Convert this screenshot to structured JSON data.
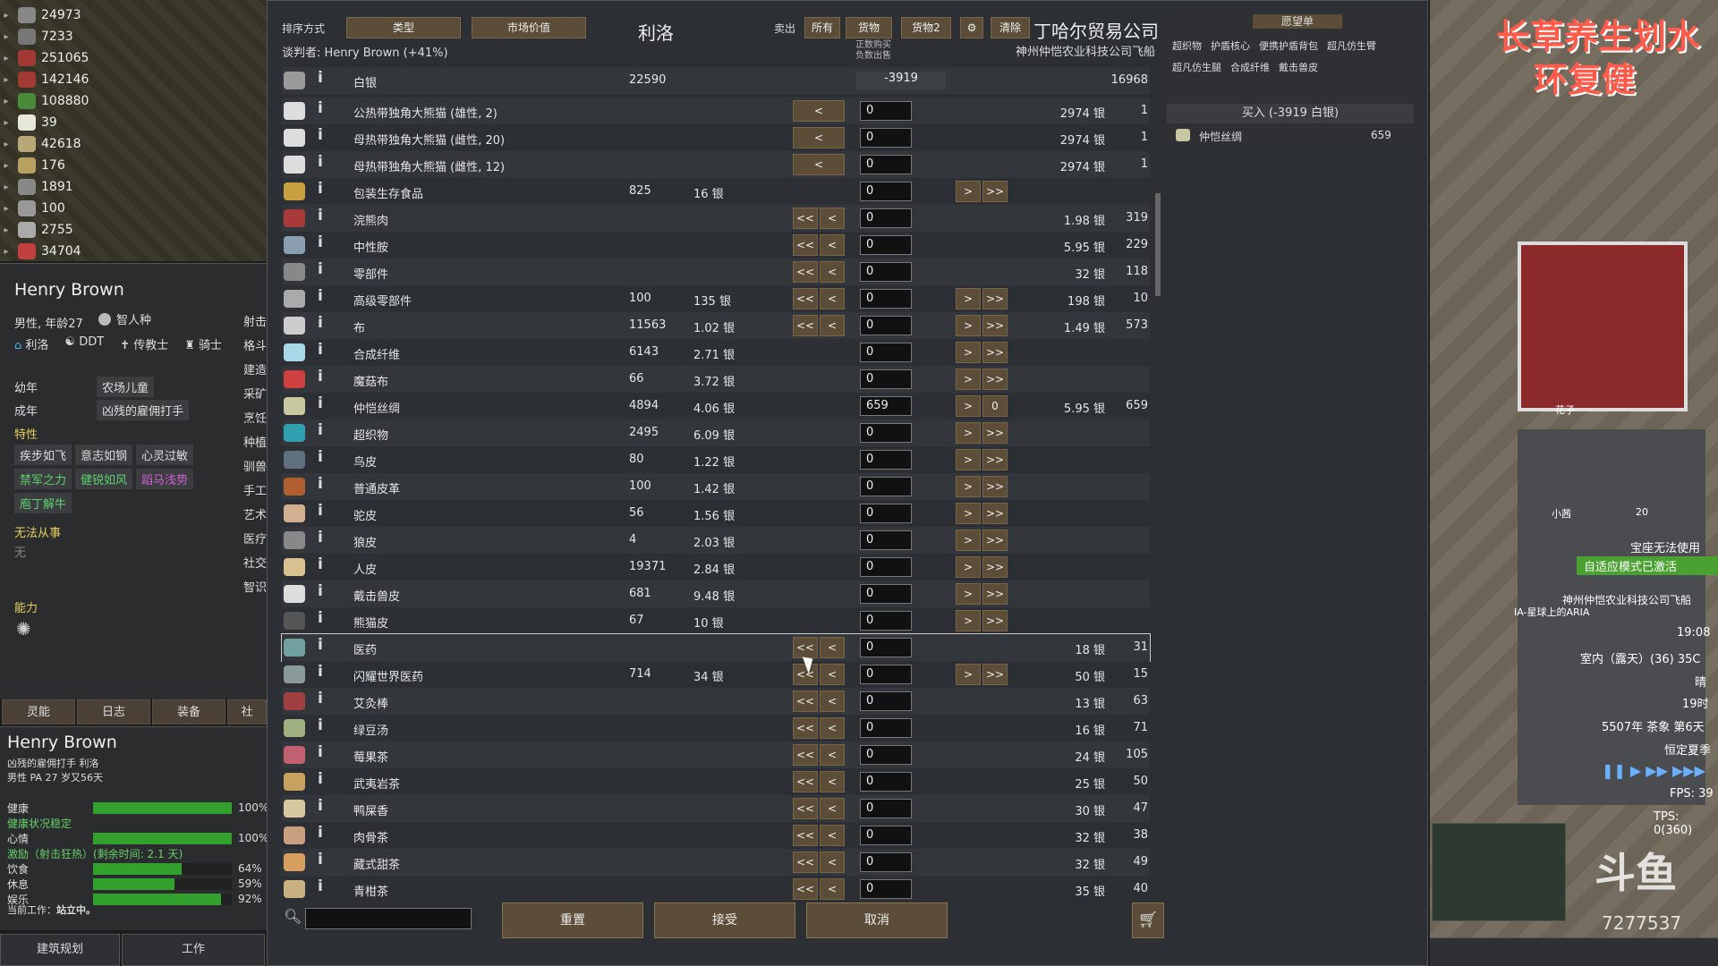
{
  "resources": [
    {
      "value": "24973",
      "color": "#888"
    },
    {
      "value": "7233",
      "color": "#777"
    },
    {
      "value": "251065",
      "color": "#a03a32"
    },
    {
      "value": "142146",
      "color": "#a03a32"
    },
    {
      "value": "108880",
      "color": "#4a8a3a"
    },
    {
      "value": "39",
      "color": "#e8e8d8"
    },
    {
      "value": "42618",
      "color": "#b8a878"
    },
    {
      "value": "176",
      "color": "#b8a060"
    },
    {
      "value": "1891",
      "color": "#888"
    },
    {
      "value": "100",
      "color": "#999"
    },
    {
      "value": "2755",
      "color": "#aaa"
    },
    {
      "value": "34704",
      "color": "#c04040"
    }
  ],
  "character": {
    "name": "Henry Brown",
    "gender_age": "男性, 年龄27",
    "race": "智人种",
    "faction": "利洛",
    "ideo": "DDT",
    "role": "传教士",
    "title": "骑士",
    "childhood_label": "幼年",
    "childhood": "农场儿童",
    "adulthood_label": "成年",
    "adulthood": "凶残的雇佣打手",
    "traits_label": "特性",
    "traits": [
      "疾步如飞",
      "意志如钢",
      "心灵过敏",
      "禁军之力",
      "健锐如风",
      "蹈马浅势",
      "庖丁解牛"
    ],
    "incapable_label": "无法从事",
    "incapable": "无",
    "abilities_label": "能力",
    "skills": [
      "射击",
      "格斗",
      "建造",
      "采矿",
      "烹饪",
      "种植",
      "驯兽",
      "手工",
      "艺术",
      "医疗",
      "社交",
      "智识"
    ]
  },
  "tabs": [
    "灵能",
    "日志",
    "装备",
    "社"
  ],
  "needs": {
    "name": "Henry Brown",
    "sub1": "凶残的雇佣打手 利洛",
    "sub2": "男性 PA 27 岁又56天",
    "rows": [
      {
        "label": "健康",
        "pct": "100%",
        "fill": 1.0
      },
      {
        "label": "健康状况稳定",
        "pct": "",
        "fill": null
      },
      {
        "label": "心情",
        "pct": "100%",
        "fill": 1.0
      },
      {
        "label": "激励（射击狂热）(剩余时间: 2.1 天)",
        "pct": "",
        "fill": null
      },
      {
        "label": "饮食",
        "pct": "64%",
        "fill": 0.64
      },
      {
        "label": "休息",
        "pct": "59%",
        "fill": 0.59
      },
      {
        "label": "娱乐",
        "pct": "92%",
        "fill": 0.92
      }
    ],
    "current_job_label": "当前工作：",
    "current_job": "站立中。"
  },
  "bottom_tabs": [
    "建筑规划",
    "工作"
  ],
  "trade": {
    "sort_label": "排序方式",
    "sort_btn1": "类型",
    "sort_btn2": "市场价值",
    "colony_name": "利洛",
    "negotiator": "谈判者: Henry Brown (+41%)",
    "sell_label": "卖出",
    "filter_all": "所有",
    "filter_goods": "货物",
    "filter_goods2": "货物2",
    "clear": "清除",
    "trader_name": "丁哈尔贸易公司",
    "trader_sub": "神州仲恺农业科技公司飞船",
    "hint1": "正数购买",
    "hint2": "负数出售",
    "silver_row": {
      "name": "白银",
      "qty": "22590",
      "balance": "-3919",
      "trader_qty": "16968"
    },
    "items": [
      {
        "name": "公热带独角大熊猫 (雄性, 2)",
        "qty": "",
        "price": "",
        "l2": "",
        "l1": "<",
        "input": "0",
        "r1": "",
        "r2": "",
        "tprice": "2974 银",
        "tqty": "1",
        "icon": "#ddd"
      },
      {
        "name": "母热带独角大熊猫 (雌性, 20)",
        "qty": "",
        "price": "",
        "l2": "",
        "l1": "<",
        "input": "0",
        "r1": "",
        "r2": "",
        "tprice": "2974 银",
        "tqty": "1",
        "icon": "#ddd"
      },
      {
        "name": "母热带独角大熊猫 (雌性, 12)",
        "qty": "",
        "price": "",
        "l2": "",
        "l1": "<",
        "input": "0",
        "r1": "",
        "r2": "",
        "tprice": "2974 银",
        "tqty": "1",
        "icon": "#ddd"
      },
      {
        "name": "包装生存食品",
        "qty": "825",
        "price": "16 银",
        "l2": "",
        "l1": "",
        "input": "0",
        "r1": ">",
        "r2": ">>",
        "tprice": "",
        "tqty": "",
        "icon": "#c8a040"
      },
      {
        "name": "浣熊肉",
        "qty": "",
        "price": "",
        "l2": "<<",
        "l1": "<",
        "input": "0",
        "r1": "",
        "r2": "",
        "tprice": "1.98 银",
        "tqty": "319",
        "icon": "#a83a3a"
      },
      {
        "name": "中性胺",
        "qty": "",
        "price": "",
        "l2": "<<",
        "l1": "<",
        "input": "0",
        "r1": "",
        "r2": "",
        "tprice": "5.95 银",
        "tqty": "229",
        "icon": "#8aa0b0"
      },
      {
        "name": "零部件",
        "qty": "",
        "price": "",
        "l2": "<<",
        "l1": "<",
        "input": "0",
        "r1": "",
        "r2": "",
        "tprice": "32 银",
        "tqty": "118",
        "icon": "#888"
      },
      {
        "name": "高级零部件",
        "qty": "100",
        "price": "135 银",
        "l2": "<<",
        "l1": "<",
        "input": "0",
        "r1": ">",
        "r2": ">>",
        "tprice": "198 银",
        "tqty": "10",
        "icon": "#aaa"
      },
      {
        "name": "布",
        "qty": "11563",
        "price": "1.02 银",
        "l2": "<<",
        "l1": "<",
        "input": "0",
        "r1": ">",
        "r2": ">>",
        "tprice": "1.49 银",
        "tqty": "573",
        "icon": "#ccc"
      },
      {
        "name": "合成纤维",
        "qty": "6143",
        "price": "2.71 银",
        "l2": "",
        "l1": "",
        "input": "0",
        "r1": ">",
        "r2": ">>",
        "tprice": "",
        "tqty": "",
        "icon": "#a8d8e8"
      },
      {
        "name": "魔菇布",
        "qty": "66",
        "price": "3.72 银",
        "l2": "",
        "l1": "",
        "input": "0",
        "r1": ">",
        "r2": ">>",
        "tprice": "",
        "tqty": "",
        "icon": "#d04040"
      },
      {
        "name": "仲恺丝绸",
        "qty": "4894",
        "price": "4.06 银",
        "l2": "",
        "l1": "",
        "input": "659",
        "r1": ">",
        "r2": "0",
        "tprice": "5.95 银",
        "tqty": "659",
        "icon": "#c8c8a0"
      },
      {
        "name": "超织物",
        "qty": "2495",
        "price": "6.09 银",
        "l2": "",
        "l1": "",
        "input": "0",
        "r1": ">",
        "r2": ">>",
        "tprice": "",
        "tqty": "",
        "icon": "#30a0b0"
      },
      {
        "name": "鸟皮",
        "qty": "80",
        "price": "1.22 银",
        "l2": "",
        "l1": "",
        "input": "0",
        "r1": ">",
        "r2": ">>",
        "tprice": "",
        "tqty": "",
        "icon": "#607080"
      },
      {
        "name": "普通皮革",
        "qty": "100",
        "price": "1.42 银",
        "l2": "",
        "l1": "",
        "input": "0",
        "r1": ">",
        "r2": ">>",
        "tprice": "",
        "tqty": "",
        "icon": "#b06030"
      },
      {
        "name": "驼皮",
        "qty": "56",
        "price": "1.56 银",
        "l2": "",
        "l1": "",
        "input": "0",
        "r1": ">",
        "r2": ">>",
        "tprice": "",
        "tqty": "",
        "icon": "#d0b090"
      },
      {
        "name": "狼皮",
        "qty": "4",
        "price": "2.03 银",
        "l2": "",
        "l1": "",
        "input": "0",
        "r1": ">",
        "r2": ">>",
        "tprice": "",
        "tqty": "",
        "icon": "#888"
      },
      {
        "name": "人皮",
        "qty": "19371",
        "price": "2.84 银",
        "l2": "",
        "l1": "",
        "input": "0",
        "r1": ">",
        "r2": ">>",
        "tprice": "",
        "tqty": "",
        "icon": "#d8c090"
      },
      {
        "name": "戴击兽皮",
        "qty": "681",
        "price": "9.48 银",
        "l2": "",
        "l1": "",
        "input": "0",
        "r1": ">",
        "r2": ">>",
        "tprice": "",
        "tqty": "",
        "icon": "#ddd"
      },
      {
        "name": "熊猫皮",
        "qty": "67",
        "price": "10 银",
        "l2": "",
        "l1": "",
        "input": "0",
        "r1": ">",
        "r2": ">>",
        "tprice": "",
        "tqty": "",
        "icon": "#555"
      },
      {
        "name": "医药",
        "qty": "",
        "price": "",
        "l2": "<<",
        "l1": "<",
        "input": "0",
        "r1": "",
        "r2": "",
        "tprice": "18 银",
        "tqty": "31",
        "icon": "#70a0a0"
      },
      {
        "name": "闪耀世界医药",
        "qty": "714",
        "price": "34 银",
        "l2": "<<",
        "l1": "<",
        "input": "0",
        "r1": ">",
        "r2": ">>",
        "tprice": "50 银",
        "tqty": "15",
        "icon": "#8a9a9a"
      },
      {
        "name": "艾灸棒",
        "qty": "",
        "price": "",
        "l2": "<<",
        "l1": "<",
        "input": "0",
        "r1": "",
        "r2": "",
        "tprice": "13 银",
        "tqty": "63",
        "icon": "#a04040"
      },
      {
        "name": "绿豆汤",
        "qty": "",
        "price": "",
        "l2": "<<",
        "l1": "<",
        "input": "0",
        "r1": "",
        "r2": "",
        "tprice": "16 银",
        "tqty": "71",
        "icon": "#a0b080"
      },
      {
        "name": "莓果茶",
        "qty": "",
        "price": "",
        "l2": "<<",
        "l1": "<",
        "input": "0",
        "r1": "",
        "r2": "",
        "tprice": "24 银",
        "tqty": "105",
        "icon": "#c06070"
      },
      {
        "name": "武夷岩茶",
        "qty": "",
        "price": "",
        "l2": "<<",
        "l1": "<",
        "input": "0",
        "r1": "",
        "r2": "",
        "tprice": "25 银",
        "tqty": "50",
        "icon": "#c8a060"
      },
      {
        "name": "鸭屎香",
        "qty": "",
        "price": "",
        "l2": "<<",
        "l1": "<",
        "input": "0",
        "r1": "",
        "r2": "",
        "tprice": "30 银",
        "tqty": "47",
        "icon": "#d8c8a0"
      },
      {
        "name": "肉骨茶",
        "qty": "",
        "price": "",
        "l2": "<<",
        "l1": "<",
        "input": "0",
        "r1": "",
        "r2": "",
        "tprice": "32 银",
        "tqty": "38",
        "icon": "#c8a080"
      },
      {
        "name": "藏式甜茶",
        "qty": "",
        "price": "",
        "l2": "<<",
        "l1": "<",
        "input": "0",
        "r1": "",
        "r2": "",
        "tprice": "32 银",
        "tqty": "49",
        "icon": "#d8a060"
      },
      {
        "name": "青柑茶",
        "qty": "",
        "price": "",
        "l2": "<<",
        "l1": "<",
        "input": "0",
        "r1": "",
        "r2": "",
        "tprice": "35 银",
        "tqty": "40",
        "icon": "#c8b080"
      }
    ],
    "reset": "重置",
    "accept": "接受",
    "cancel": "取消"
  },
  "wishlist": {
    "title": "愿望单",
    "items": [
      "超织物",
      "护盾核心",
      "便携护盾背包",
      "超凡仿生臂",
      "超凡仿生腿",
      "合成纤维",
      "戴击兽皮"
    ],
    "buy_header": "买入 (-3919 白银)",
    "buy_item": "仲恺丝绸",
    "buy_qty": "659"
  },
  "overlay": {
    "title_line1": "长草养生划水",
    "title_line2": "环复健",
    "label_flowers": "花子",
    "label_xiaoyu": "小茜",
    "label_20": "20",
    "msg1": "宝座无法使用",
    "msg2": "自适应模式已激活",
    "msg3": "神州仲恺农业科技公司飞船",
    "msg4": "IA-星球上的ARIA",
    "time": "19:08",
    "weather": "室内（露天）(36) 35C",
    "sky": "晴",
    "hour": "19时",
    "date": "5507年 茶象 第6天",
    "season": "恒定夏季",
    "fps": "FPS: 39",
    "tps": "TPS: 0(360)",
    "watermark": "斗鱼",
    "room_id": "7277537"
  }
}
